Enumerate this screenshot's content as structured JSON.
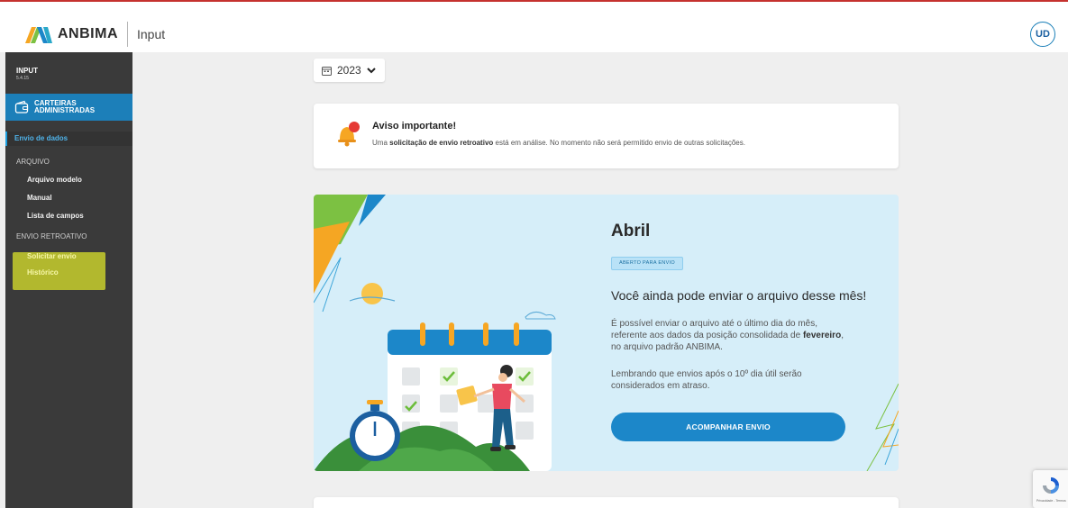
{
  "header": {
    "brand": "ANBIMA",
    "product": "Input",
    "user_initials": "UD",
    "accent_color": "#c5322f"
  },
  "sidebar": {
    "title": "INPUT",
    "version": "5.4.15",
    "module": "CARTEIRAS ADMINISTRADAS",
    "active_item": "Envio de dados",
    "sections": [
      {
        "label": "ARQUIVO",
        "items": [
          "Arquivo modelo",
          "Manual",
          "Lista de campos"
        ]
      },
      {
        "label": "ENVIO RETROATIVO",
        "items": [
          "Solicitar envio",
          "Histórico"
        ]
      }
    ],
    "highlight_color": "#c8cf2d"
  },
  "year_selector": {
    "value": "2023",
    "icon": "calendar-icon"
  },
  "notice": {
    "title": "Aviso importante!",
    "text_before": "Uma ",
    "text_bold": "solicitação de envio retroativo",
    "text_after": " está em análise. No momento não será permitido envio de outras solicitações.",
    "icon": "bell-icon"
  },
  "banner": {
    "month": "Abril",
    "status": "ABERTO PARA ENVIO",
    "headline": "Você ainda pode enviar o arquivo desse mês!",
    "p1_before": "É possível enviar o arquivo até o último dia do mês, referente aos dados da posição consolidada de ",
    "p1_bold": "fevereiro",
    "p1_after": ", no arquivo padrão ANBIMA.",
    "p2": "Lembrando que envios após o 10º dia útil serão considerados em atraso.",
    "button": "ACOMPANHAR ENVIO",
    "brand_color": "#1c87c9"
  },
  "recaptcha": {
    "label": "Privacidade - Termos"
  }
}
